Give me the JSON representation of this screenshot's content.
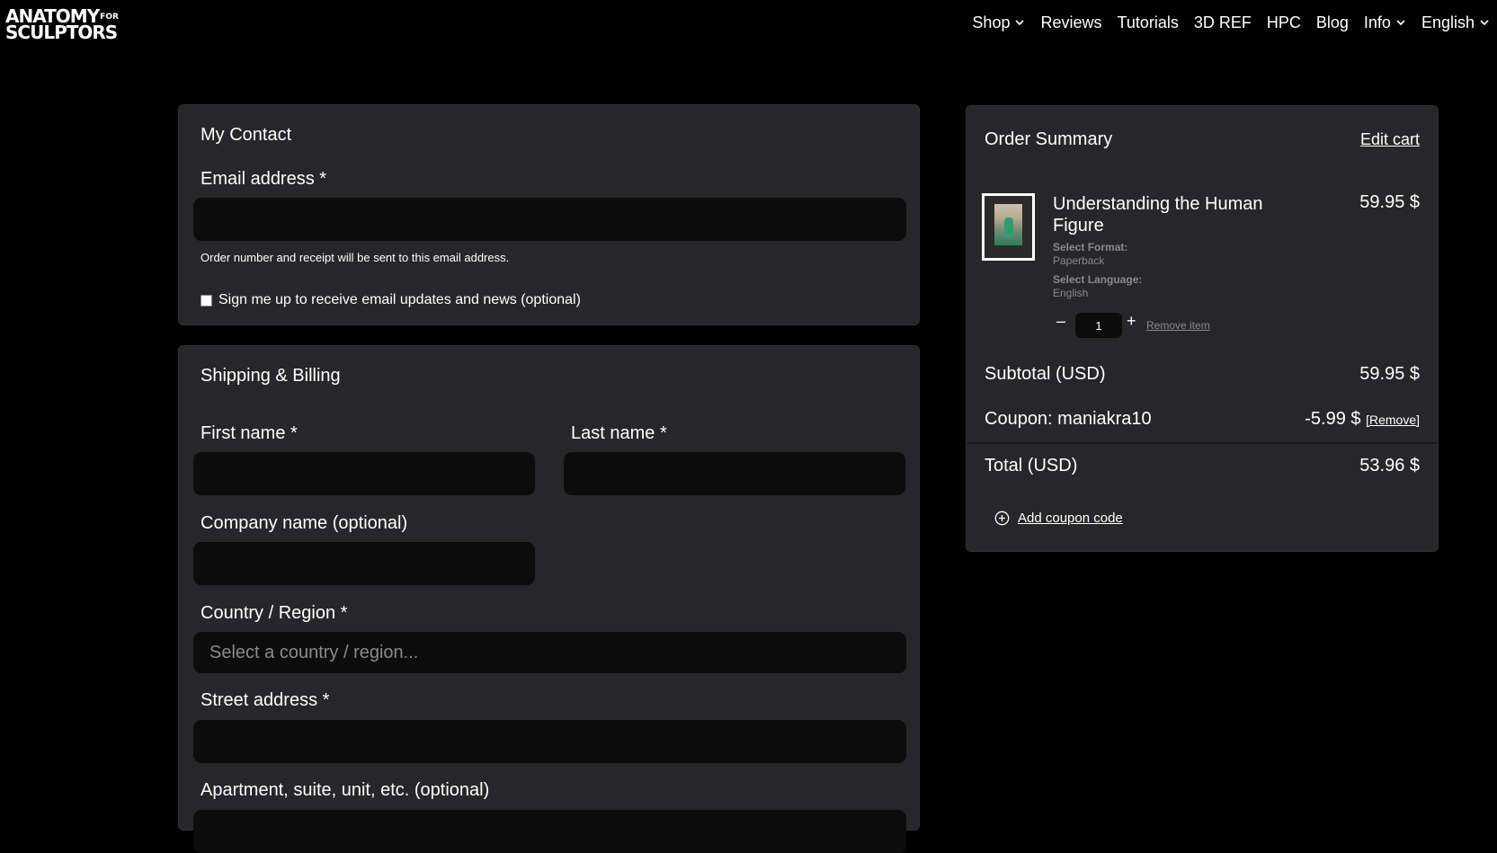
{
  "brand": {
    "line1": "ANATOMY",
    "line1_small": "FOR",
    "line2": "SCULPTORS"
  },
  "nav": {
    "items": [
      {
        "label": "Shop",
        "dropdown": true
      },
      {
        "label": "Reviews",
        "dropdown": false
      },
      {
        "label": "Tutorials",
        "dropdown": false
      },
      {
        "label": "3D REF",
        "dropdown": false
      },
      {
        "label": "HPC",
        "dropdown": false
      },
      {
        "label": "Blog",
        "dropdown": false
      },
      {
        "label": "Info",
        "dropdown": true
      },
      {
        "label": "English",
        "dropdown": true
      }
    ]
  },
  "contact": {
    "title": "My Contact",
    "email_label": "Email address *",
    "email_value": "",
    "email_help": "Order number and receipt will be sent to this email address.",
    "newsletter_label": "Sign me up to receive email updates and news (optional)",
    "newsletter_checked": false
  },
  "shipping": {
    "title": "Shipping & Billing",
    "first_name_label": "First name *",
    "last_name_label": "Last name *",
    "company_label": "Company name (optional)",
    "country_label": "Country / Region *",
    "country_placeholder": "Select a country / region...",
    "street_label": "Street address *",
    "apartment_label": "Apartment, suite, unit, etc. (optional)"
  },
  "summary": {
    "title": "Order Summary",
    "edit_cart": "Edit cart",
    "item": {
      "name": "Understanding the Human Figure",
      "price": "59.95 $",
      "format_label": "Select Format:",
      "format_value": "Paperback",
      "language_label": "Select Language:",
      "language_value": "English",
      "quantity": "1",
      "minus": "–",
      "plus": "+",
      "remove_label": "Remove item"
    },
    "subtotal_label": "Subtotal (USD)",
    "subtotal_value": "59.95 $",
    "coupon_label": "Coupon: maniakra10",
    "coupon_value": "-5.99 $",
    "coupon_remove": "[Remove]",
    "total_label": "Total (USD)",
    "total_value": "53.96 $",
    "add_coupon": "Add coupon code"
  },
  "colors": {
    "background": "#000000",
    "panel": "#27272a",
    "input": "#0c0c0d",
    "muted": "#8a8a8e"
  },
  "icons": [
    "chevron-down-icon",
    "plus-circle-icon",
    "book-cover-thumbnail"
  ]
}
